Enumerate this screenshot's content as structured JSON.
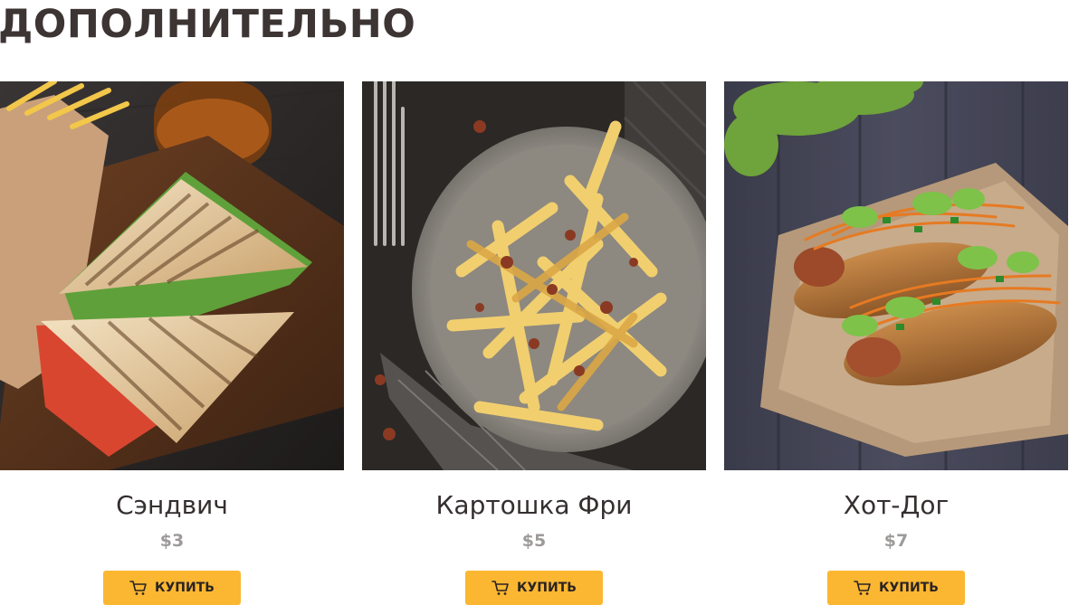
{
  "section": {
    "title": "ДОПОЛНИТЕЛЬНО"
  },
  "products": [
    {
      "name": "Сэндвич",
      "price": "$3",
      "buy_label": "КУПИТЬ",
      "photo": "sandwich-photo"
    },
    {
      "name": "Картошка Фри",
      "price": "$5",
      "buy_label": "КУПИТЬ",
      "photo": "fries-photo"
    },
    {
      "name": "Хот-Дог",
      "price": "$7",
      "buy_label": "КУПИТЬ",
      "photo": "hotdog-photo"
    }
  ],
  "colors": {
    "accent": "#fbb731",
    "title": "#3d3434",
    "price": "#9e9a9a"
  },
  "icons": {
    "buy": "cart-icon"
  }
}
